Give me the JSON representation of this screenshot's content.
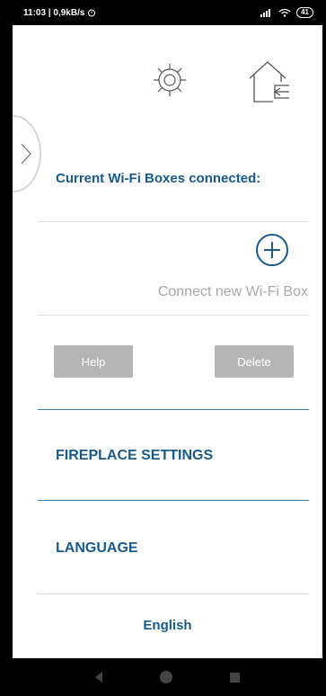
{
  "status_bar": {
    "time_speed": "11:03 | 0,9kB/s",
    "battery": "41"
  },
  "icons": {
    "settings": "gear-icon",
    "home_back": "home-back-icon",
    "side_toggle": "chevron-right-icon",
    "add": "plus-icon"
  },
  "wifi": {
    "title": "Current Wi-Fi Boxes connected:",
    "connect_label": "Connect new Wi-Fi Box"
  },
  "buttons": {
    "help": "Help",
    "delete": "Delete"
  },
  "sections": {
    "fireplace": "FIREPLACE SETTINGS",
    "language": "LANGUAGE",
    "language_value": "English"
  },
  "colors": {
    "accent": "#1a5a8a",
    "button_disabled": "#b5b5b5",
    "muted_text": "#a8a8a8"
  }
}
